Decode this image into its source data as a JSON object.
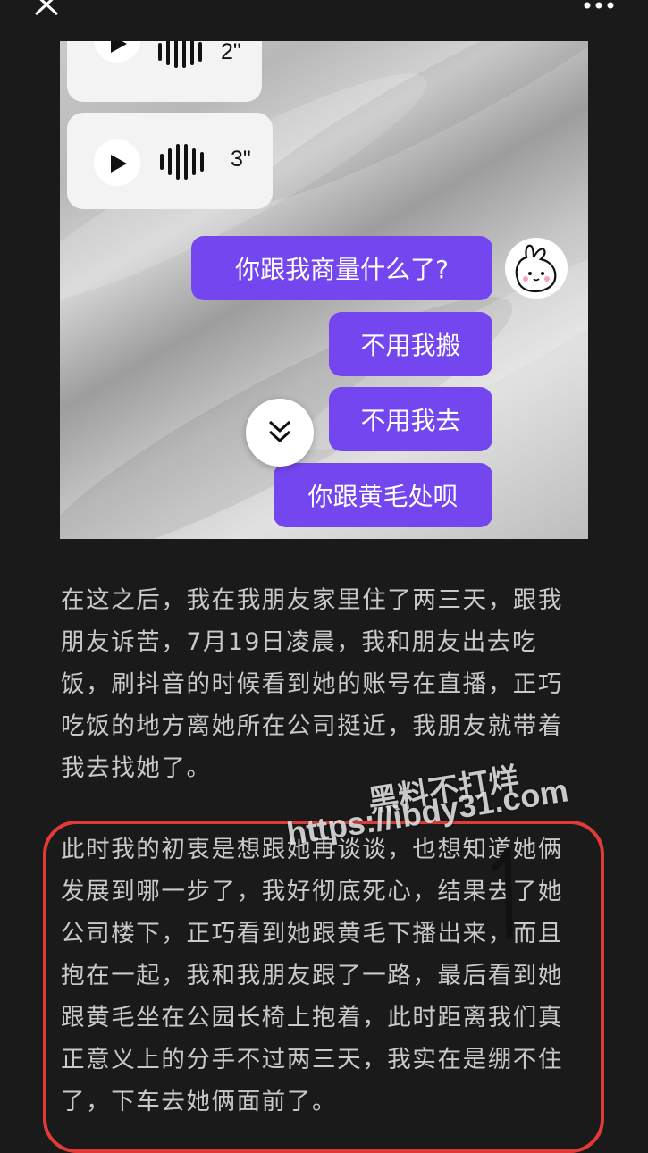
{
  "header": {
    "close_icon": "close-icon",
    "more_icon": "more-icon"
  },
  "chat": {
    "voice_messages": [
      {
        "duration": "2\""
      },
      {
        "duration": "3\""
      }
    ],
    "messages": [
      {
        "text": "你跟我商量什么了?"
      },
      {
        "text": "不用我搬"
      },
      {
        "text": "不用我去"
      },
      {
        "text": "你跟黄毛处呗"
      }
    ],
    "accent_color": "#7446f0"
  },
  "article": {
    "paragraph1": [
      "在这之后，我在我朋友家里住了两三天，跟我",
      "朋友诉苦，7月19日凌晨，我和朋友出去吃",
      "饭，刷抖音的时候看到她的账号在直播，正巧",
      "吃饭的地方离她所在公司挺近，我朋友就带着",
      "我去找她了。"
    ],
    "paragraph2": [
      "此时我的初衷是想跟她再谈谈，也想知道她俩",
      "发展到哪一步了，我好彻底死心，结果去了她",
      "公司楼下，正巧看到她跟黄毛下播出来，而且",
      "抱在一起，我和我朋友跟了一路，最后看到她",
      "跟黄毛坐在公园长椅上抱着，此时距离我们真",
      "正意义上的分手不过两三天，我实在是绷不住",
      "了，下车去她俩面前了。"
    ]
  },
  "watermark": {
    "line1": "黑料不打烊",
    "line2": "https://ibdy31.com"
  }
}
